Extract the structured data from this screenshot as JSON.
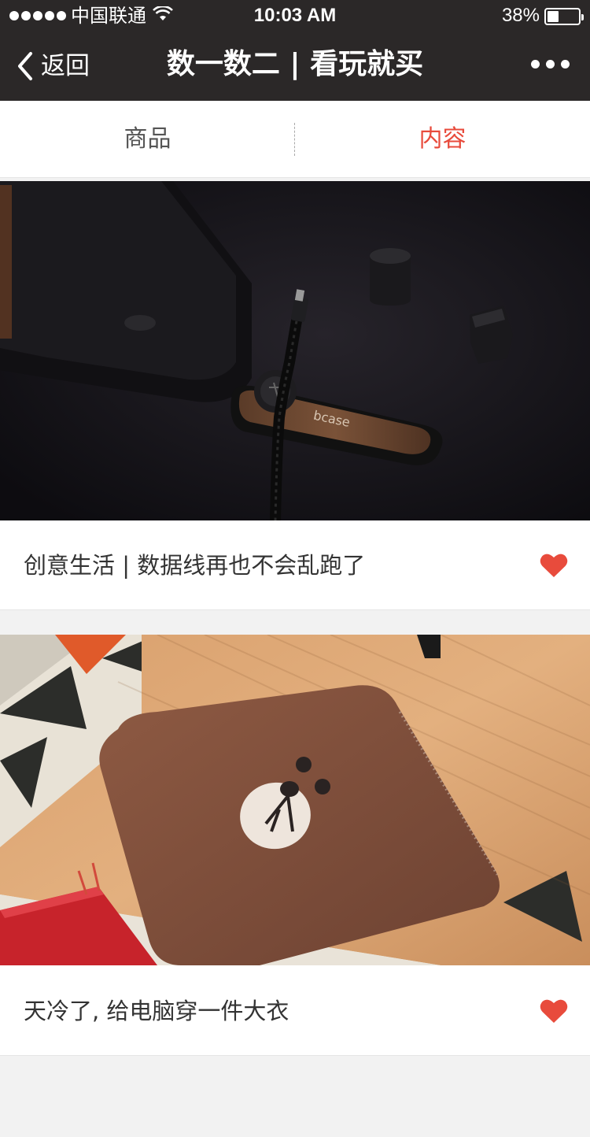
{
  "status_bar": {
    "carrier": "中国联通",
    "time": "10:03 AM",
    "battery_pct": "38%",
    "battery_level": 0.38
  },
  "nav": {
    "back_label": "返回",
    "title": "数一数二 | 看玩就买",
    "back_icon": "chevron-left-icon",
    "more_icon": "more-dots-icon"
  },
  "tabs": [
    {
      "label": "商品",
      "active": false
    },
    {
      "label": "内容",
      "active": true
    }
  ],
  "cards": [
    {
      "title": "创意生活 | 数据线再也不会乱跑了",
      "image_brand": "bcase",
      "liked": true
    },
    {
      "title": "天冷了, 给电脑穿一件大衣",
      "liked": true
    }
  ],
  "colors": {
    "accent": "#e84b3c",
    "nav_bg": "#2b2828",
    "page_bg": "#f2f2f2"
  }
}
